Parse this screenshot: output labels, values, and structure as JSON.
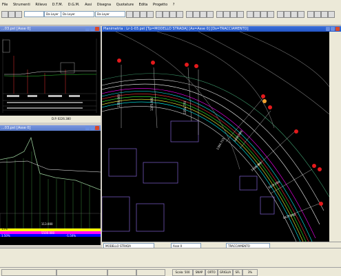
{
  "menu": [
    "File",
    "Strumenti",
    "Rilievo",
    "D.T.M.",
    "D.G.M.",
    "Assi",
    "Disegna",
    "Quotature",
    "Edita",
    "Progetto",
    "?"
  ],
  "toolbar": {
    "layer_selects": [
      "Da Layer",
      "Da Layer",
      "Da Layer"
    ],
    "bottom_selects": [
      "Da Layer",
      "Da Layer"
    ]
  },
  "windows": {
    "profile": {
      "title": "...03.pst [Asse 0]",
      "ruler": "D.P. 0226.380"
    },
    "section": {
      "title": "...03.pst [Asse 0]",
      "bands": [
        "15%",
        "113.000",
        "",
        "5500.000",
        "-1.50%",
        "1.50%"
      ]
    },
    "plan": {
      "title": "Planimetria : Lr-1-03.pst [Tp=MODELLO STRADA] [As=Asse 0] [Ds=TRACCIAMENTO]",
      "layer_bar": [
        "MODELLO STRADA",
        "Asse 0",
        "TRACCIAMENTO"
      ],
      "labels": [
        "1350.000",
        "1375.000",
        "1354.770",
        "1394.715",
        "1400.000",
        "1416.380",
        "3128.000",
        "1425.000",
        "1128.000"
      ]
    }
  },
  "status": [
    "Scala: 500",
    "SNAP",
    "ORTO",
    "GRIGLIA",
    "SFL",
    "3%"
  ],
  "colors": {
    "window_title": "#2456c7",
    "canvas": "#000000",
    "marker": "#e31a1c"
  }
}
